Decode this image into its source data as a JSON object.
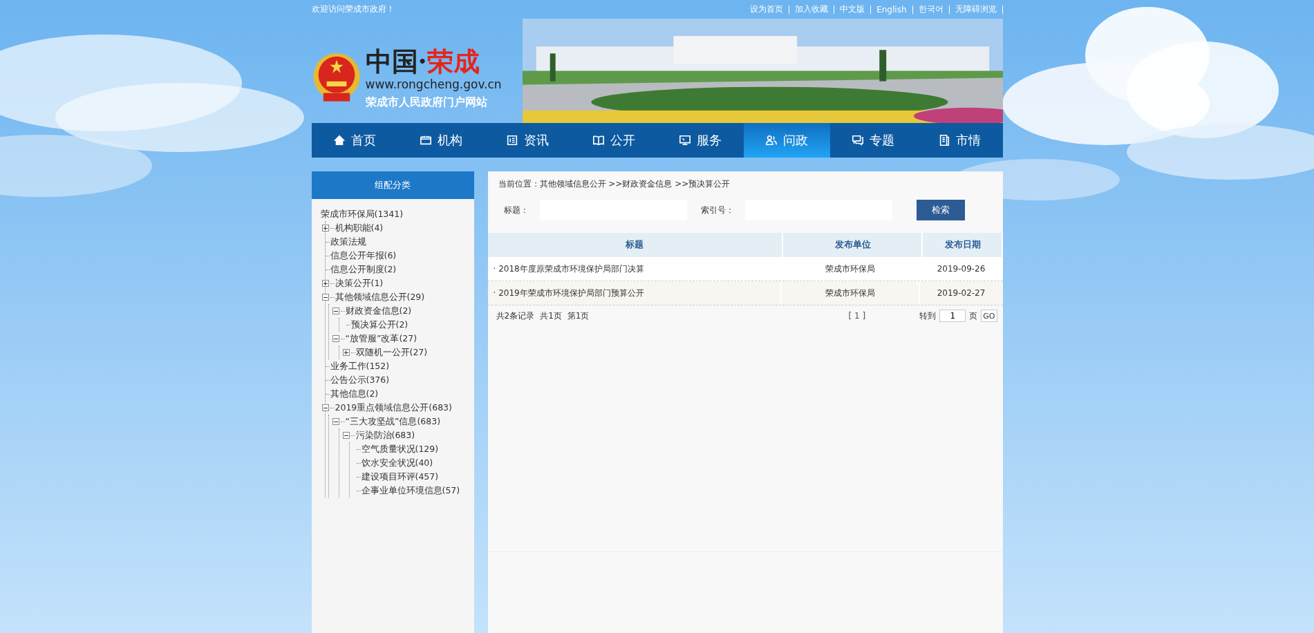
{
  "top_bar": {
    "welcome": "欢迎访问荣成市政府！",
    "links": [
      "设为首页",
      "加入收藏",
      "中文版",
      "English",
      "한국어",
      "无障碍浏览"
    ]
  },
  "header": {
    "logo_prefix": "中国·",
    "logo_name": "荣成",
    "url": "www.rongcheng.gov.cn",
    "site_name": "荣成市人民政府门户网站"
  },
  "nav": [
    {
      "label": "首页",
      "selected": false
    },
    {
      "label": "机构",
      "selected": false
    },
    {
      "label": "资讯",
      "selected": false
    },
    {
      "label": "公开",
      "selected": false
    },
    {
      "label": "服务",
      "selected": false
    },
    {
      "label": "问政",
      "selected": true
    },
    {
      "label": "专题",
      "selected": false
    },
    {
      "label": "市情",
      "selected": false
    }
  ],
  "sidebar": {
    "title": "组配分类",
    "tree": {
      "label": "荣成市环保局(1341)",
      "children": [
        {
          "label": "机构职能(4)",
          "kind": "folder",
          "expanded": false
        },
        {
          "label": "政策法规",
          "kind": "leaf"
        },
        {
          "label": "信息公开年报(6)",
          "kind": "leaf"
        },
        {
          "label": "信息公开制度(2)",
          "kind": "leaf"
        },
        {
          "label": "决策公开(1)",
          "kind": "folder",
          "expanded": false
        },
        {
          "label": "其他领域信息公开(29)",
          "kind": "folder",
          "expanded": true,
          "children": [
            {
              "label": "财政资金信息(2)",
              "kind": "folder",
              "expanded": true,
              "children": [
                {
                  "label": "预决算公开(2)",
                  "kind": "leaf"
                }
              ]
            },
            {
              "label": "“放管服”改革(27)",
              "kind": "folder",
              "expanded": true,
              "children": [
                {
                  "label": "双随机一公开(27)",
                  "kind": "folder",
                  "expanded": false
                }
              ]
            }
          ]
        },
        {
          "label": "业务工作(152)",
          "kind": "leaf"
        },
        {
          "label": "公告公示(376)",
          "kind": "leaf"
        },
        {
          "label": "其他信息(2)",
          "kind": "leaf"
        },
        {
          "label": "2019重点领域信息公开(683)",
          "kind": "folder",
          "expanded": true,
          "children": [
            {
              "label": "“三大攻坚战”信息(683)",
              "kind": "folder",
              "expanded": true,
              "children": [
                {
                  "label": "污染防治(683)",
                  "kind": "folder",
                  "expanded": true,
                  "children": [
                    {
                      "label": "空气质量状况(129)",
                      "kind": "leaf"
                    },
                    {
                      "label": "饮水安全状况(40)",
                      "kind": "leaf"
                    },
                    {
                      "label": "建设项目环评(457)",
                      "kind": "leaf"
                    },
                    {
                      "label": "企事业单位环境信息(57)",
                      "kind": "leaf"
                    }
                  ]
                }
              ]
            }
          ]
        }
      ]
    }
  },
  "breadcrumb": "当前位置：其他领域信息公开 >>财政资金信息 >>预决算公开",
  "search": {
    "title_label": "标题：",
    "index_label": "索引号：",
    "button": "检索"
  },
  "table": {
    "columns": [
      "标题",
      "发布单位",
      "发布日期"
    ],
    "rows": [
      {
        "title": "· 2018年度原荣成市环境保护局部门决算",
        "unit": "荣成市环保局",
        "date": "2019-09-26"
      },
      {
        "title": "· 2019年荣成市环境保护局部门预算公开",
        "unit": "荣成市环保局",
        "date": "2019-02-27"
      }
    ]
  },
  "pager": {
    "records": "共2条记录",
    "pages": "共1页",
    "current": "第1页",
    "page_links": "[ 1 ]",
    "goto_label": "转到",
    "goto_value": "1",
    "page_unit": "页",
    "go_button": "GO"
  }
}
